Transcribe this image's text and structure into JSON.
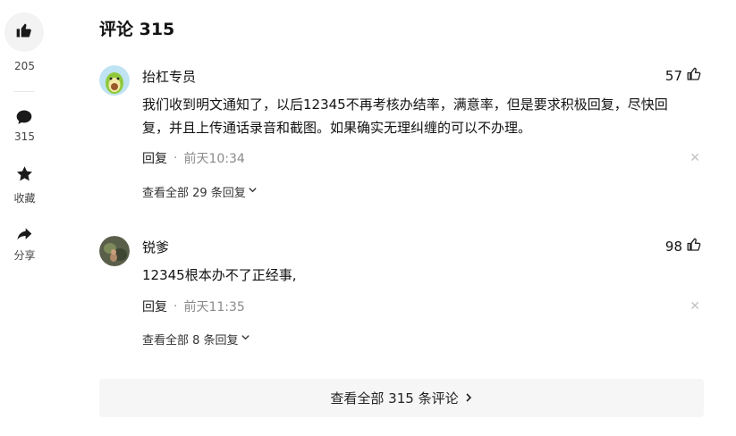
{
  "rail": {
    "like_count": "205",
    "comment_count": "315",
    "favorite_label": "收藏",
    "share_label": "分享"
  },
  "comments_section": {
    "title": "评论 315",
    "view_all_label": "查看全部 315 条评论"
  },
  "comments": [
    {
      "author": "抬杠专员",
      "likes": "57",
      "text_line1": "我们收到明文通知了，以后12345不再考核办结率，满意率，但是要求积极回复，尽快回",
      "text_line2": "复，并且上传通话录音和截图。如果确实无理纠缠的可以不办理。",
      "reply_label": "回复",
      "dot": "·",
      "time": "前天10:34",
      "view_replies": "查看全部 29 条回复"
    },
    {
      "author": "锐爹",
      "likes": "98",
      "text_line1": "12345根本办不了正经事,",
      "reply_label": "回复",
      "dot": "·",
      "time": "前天11:35",
      "view_replies": "查看全部 8 条回复"
    }
  ],
  "icons": {
    "rail": [
      "thumbs-up-icon",
      "comment-bubble-icon",
      "star-icon",
      "share-arrow-icon"
    ],
    "comment": [
      "thumbs-up-outline-icon",
      "close-icon",
      "chevron-down-icon",
      "chevron-right-icon"
    ]
  },
  "colors": {
    "text": "#121212",
    "muted": "#8a8a8a",
    "button_bg": "#f6f6f6",
    "rail_circle": "#f3f3f3"
  }
}
